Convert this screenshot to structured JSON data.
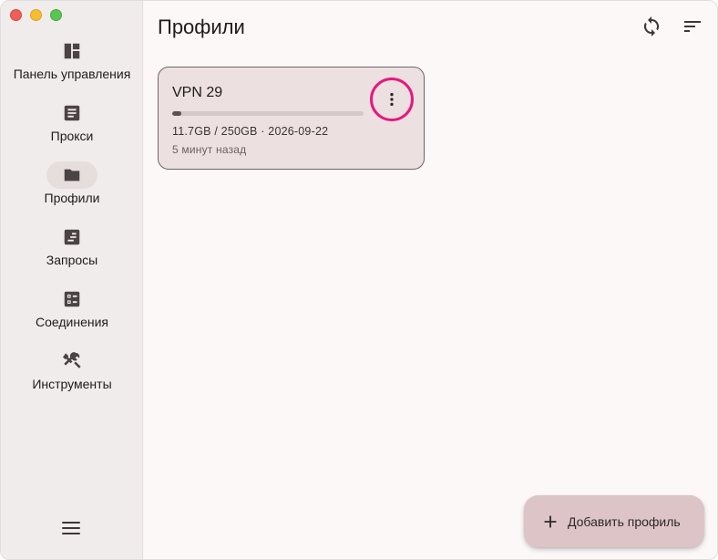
{
  "window": {
    "controls": [
      "close",
      "minimize",
      "zoom"
    ]
  },
  "sidebar": {
    "items": [
      {
        "id": "dashboard",
        "label": "Панель управления",
        "icon": "dashboard-icon",
        "active": false
      },
      {
        "id": "proxies",
        "label": "Прокси",
        "icon": "article-icon",
        "active": false
      },
      {
        "id": "profiles",
        "label": "Профили",
        "icon": "folder-icon",
        "active": true
      },
      {
        "id": "requests",
        "label": "Запросы",
        "icon": "requests-icon",
        "active": false
      },
      {
        "id": "connections",
        "label": "Соединения",
        "icon": "checklist-icon",
        "active": false
      },
      {
        "id": "tools",
        "label": "Инструменты",
        "icon": "tools-icon",
        "active": false
      }
    ],
    "menu_icon": "hamburger-menu-icon"
  },
  "header": {
    "title": "Профили",
    "actions": [
      {
        "id": "sync",
        "icon": "sync-icon"
      },
      {
        "id": "sort",
        "icon": "sort-icon"
      }
    ]
  },
  "profiles": [
    {
      "name": "VPN 29",
      "usage_text": "11.7GB / 250GB · 2026-09-22",
      "usage_fraction": 0.047,
      "updated": "5 минут назад",
      "menu_icon": "more-vertical-icon"
    }
  ],
  "fab": {
    "label": "Добавить профиль",
    "icon": "plus-icon"
  },
  "colors": {
    "accent_highlight": "#e8177e",
    "fab_bg": "#ddc4c7",
    "card_bg": "#ece0e0",
    "sidebar_bg": "#f1ecec"
  }
}
